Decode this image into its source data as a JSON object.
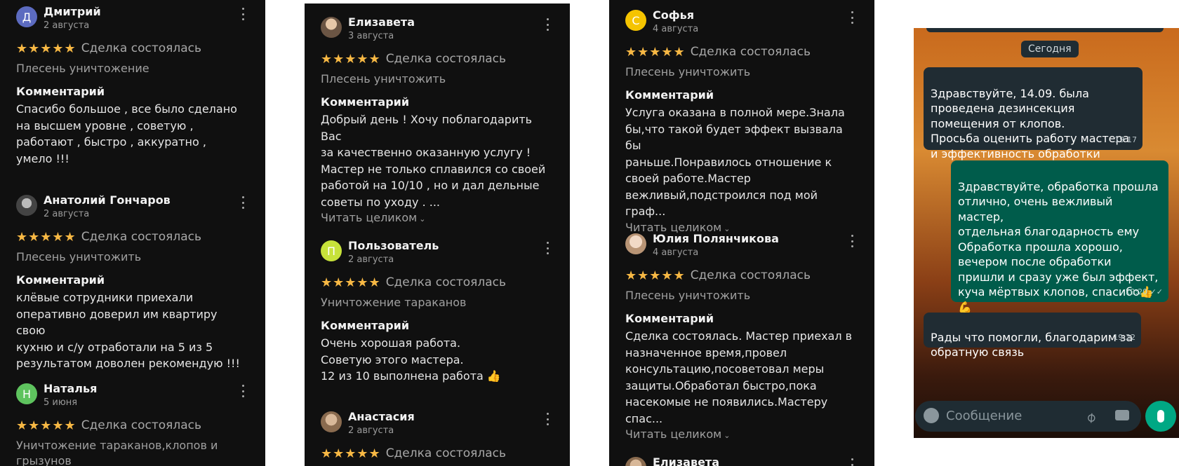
{
  "colors": {
    "panel_bg": "#101010",
    "star": "#f7b844",
    "chat_in": "#202c33",
    "chat_out": "#005c4b",
    "mic": "#00a884"
  },
  "labels": {
    "deal": "Сделка состоялась",
    "comment": "Комментарий",
    "read_more": "Читать целиком",
    "stars": "★★★★★"
  },
  "col1": [
    {
      "initial": "Д",
      "name": "Дмитрий",
      "date": "2 августа",
      "service": "Плесень уничтожение",
      "text": "Спасибо большое , все было сделано\nна высшем уровне , советую ,\nработают , быстро , аккуратно ,\nумело !!!"
    },
    {
      "initial": "",
      "name": "Анатолий Гончаров",
      "date": "2 августа",
      "service": "Плесень уничтожить",
      "text": "клёвые сотрудники приехали\nоперативно доверил им квартиру  свою\nкухню и с/у отработали на 5 из 5\nрезультатом доволен рекомендую !!!"
    },
    {
      "initial": "Н",
      "name": "Наталья",
      "date": "5 июня",
      "service": "Уничтожение тараканов,клопов и\nгрызунов"
    }
  ],
  "col2": [
    {
      "name": "Елизавета",
      "date": "3 августа",
      "service": "Плесень уничтожить",
      "text": "Добрый день ! Хочу поблагодарить Вас\nза качественно оказанную услугу !\nМастер не только сплавился со своей\nработой на 10/10 , но и дал дельные\nсоветы по уходу . ..."
    },
    {
      "initial": "П",
      "name": "Пользователь",
      "date": "2 августа",
      "service": "Уничтожение тараканов",
      "text": "Очень хорошая работа.\nСоветую этого мастера.\n12 из 10 выполнена работа 👍"
    },
    {
      "name": "Анастасия",
      "date": "2 августа"
    }
  ],
  "col3": [
    {
      "initial": "С",
      "name": "Софья",
      "date": "4 августа",
      "service": "Плесень уничтожить",
      "text": "Услуга оказана в полной мере.Знала\nбы,что такой будет эффект вызвала бы\nраньше.Понравилось отношение к\nсвоей работе.Мастер\nвежливый,подстроился под мой граф..."
    },
    {
      "name": "Юлия Полянчикова",
      "date": "4 августа",
      "service": "Плесень уничтожить",
      "text": "Сделка состоялась. Мастер приехал в\nназначенное время,провел\nконсультацию,посоветовал меры\nзащиты.Обработал быстро,пока\nнасекомые не появились.Мастеру спас..."
    },
    {
      "name": "Елизавета"
    }
  ],
  "chat": {
    "day": "Сегодня",
    "messages": [
      {
        "text": "Здравствуйте, 14.09. была\nпроведена дезинсекция\nпомещения от клопов.\nПросьба оценить работу мастера\nи эффективность обработки",
        "time": "19:17"
      },
      {
        "text": "Здравствуйте, обработка прошла\nотлично, очень вежливый мастер,\nотдельная благодарность ему\nОбработка прошла хорошо,\nвечером после обработки\nпришли и сразу уже был эффект,\nкуча мёртвых клопов, спасибо👍\n💪",
        "time": "19:20"
      },
      {
        "text": "Рады что помогли, благодарим за\nобратную связь",
        "time": "19:22"
      }
    ],
    "input_placeholder": "Сообщение"
  }
}
